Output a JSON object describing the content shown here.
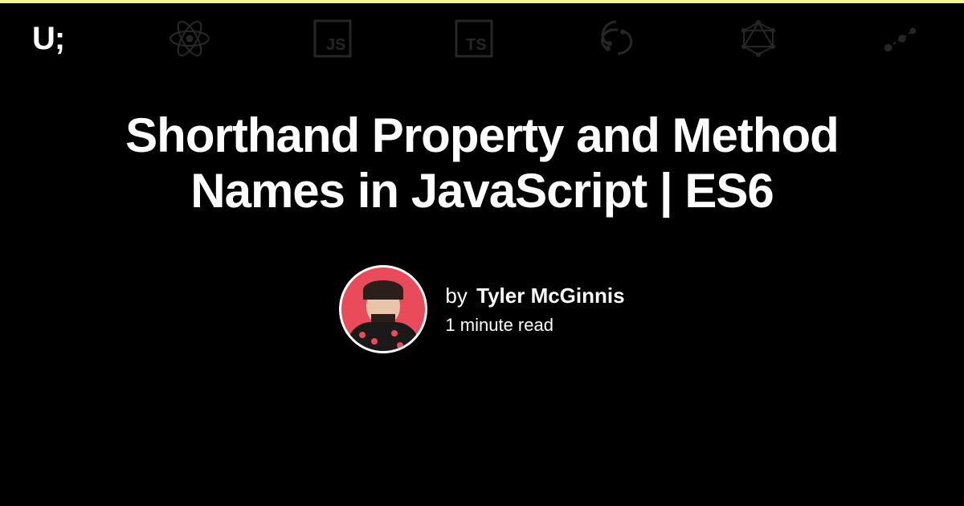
{
  "brand": {
    "logo": "U;"
  },
  "title": "Shorthand Property and Method Names in JavaScript | ES6",
  "author": {
    "by_label": "by",
    "name": "Tyler McGinnis"
  },
  "read_time": "1 minute read",
  "tech_icons": [
    "react",
    "javascript",
    "typescript",
    "redux",
    "graphql",
    "nodes"
  ]
}
